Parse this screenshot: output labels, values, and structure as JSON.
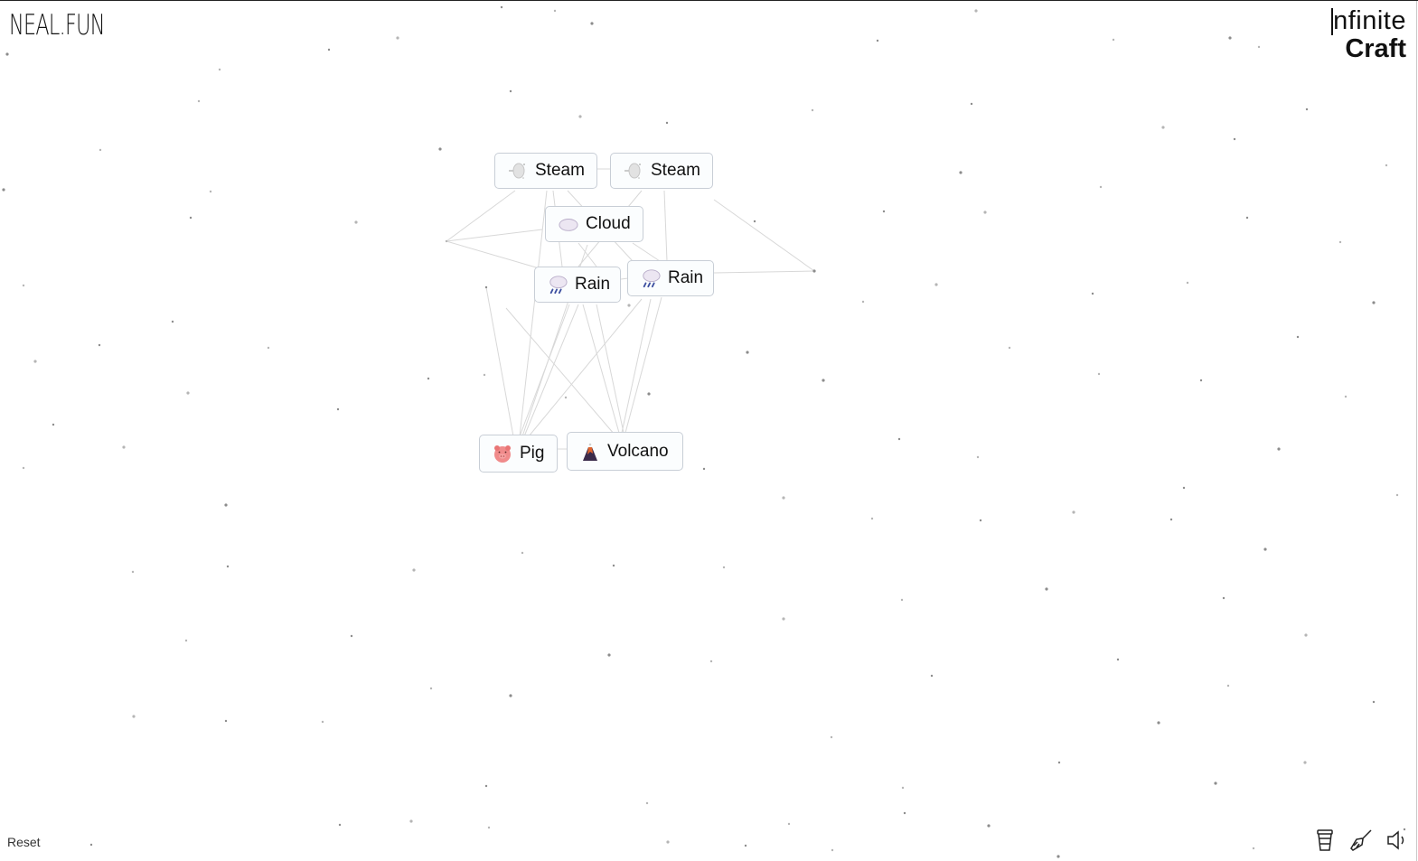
{
  "header": {
    "site_logo": "NEAL.FUN",
    "app_title_line1": "nfinite",
    "app_title_line2": "Craft"
  },
  "workspace_items": [
    {
      "name": "Steam",
      "icon": "steam-icon"
    },
    {
      "name": "Steam",
      "icon": "steam-icon"
    },
    {
      "name": "Cloud",
      "icon": "cloud-icon"
    },
    {
      "name": "Rain",
      "icon": "rain-icon"
    },
    {
      "name": "Rain",
      "icon": "rain-icon"
    },
    {
      "name": "Pig",
      "icon": "pig-icon"
    },
    {
      "name": "Volcano",
      "icon": "volcano-icon"
    }
  ],
  "footer": {
    "reset_label": "Reset",
    "tools": [
      "coffee-cup-icon",
      "broom-icon",
      "speaker-icon"
    ]
  },
  "colors": {
    "item_border": "#c8ced6",
    "item_background": "#fbfdfe",
    "connection_line": "#d8d8d8",
    "particle": "#9a9a9a"
  }
}
